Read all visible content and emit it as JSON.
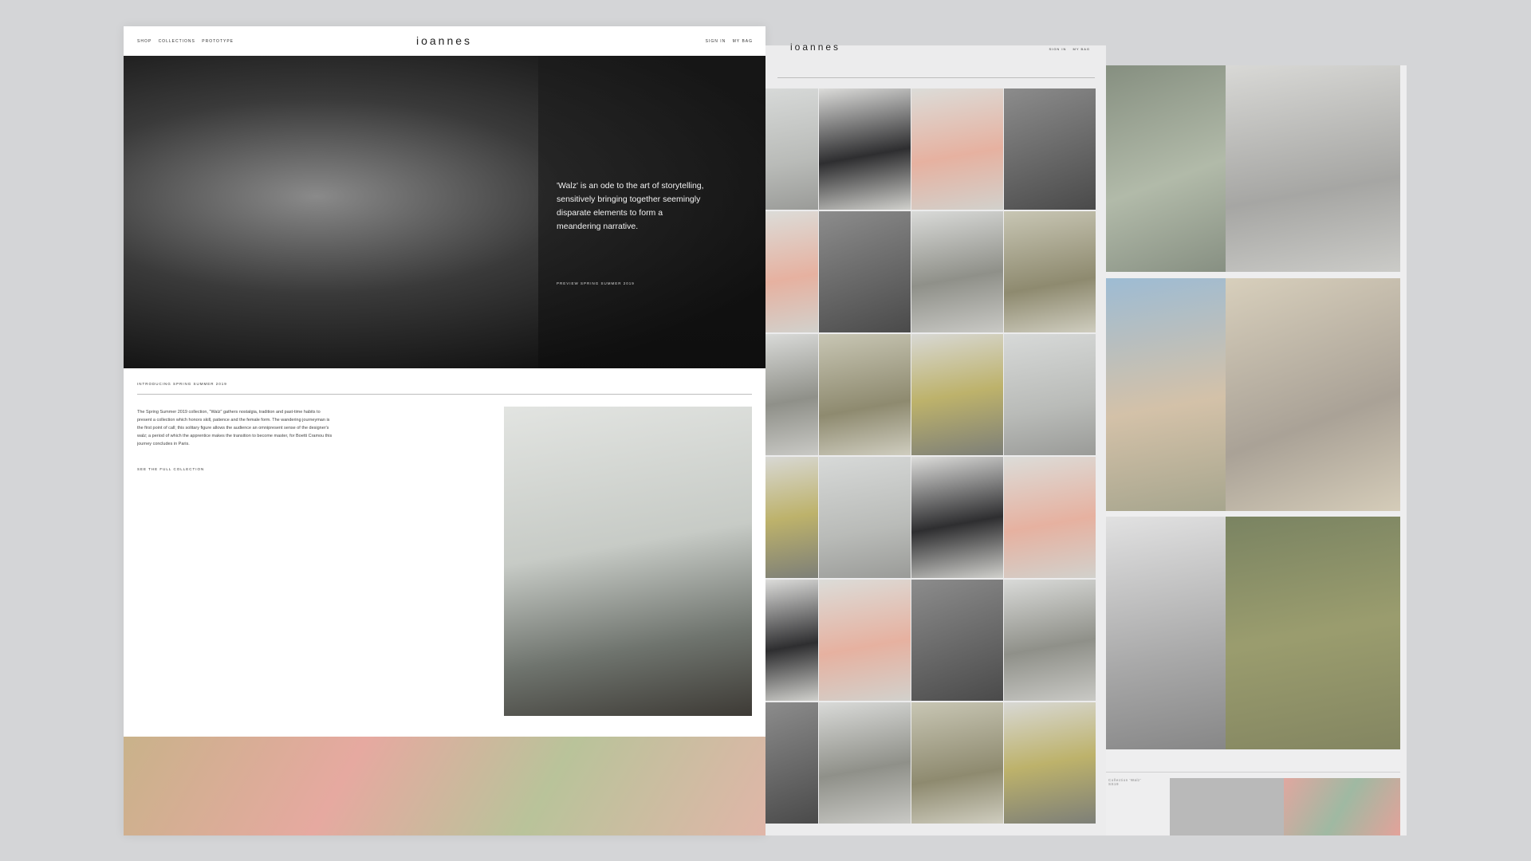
{
  "page1": {
    "nav_links": [
      "SHOP",
      "COLLECTIONS",
      "PROTOTYPE"
    ],
    "logo": "ioannes",
    "account_links": [
      "SIGN IN",
      "MY BAG"
    ],
    "hero": {
      "text": "'Walz' is an ode to the art of storytelling, sensitively bringing together seemingly disparate elements to form a meandering narrative.",
      "link": "PREVIEW SPRING SUMMER 2019"
    },
    "section_label": "INTRODUCING SPRING SUMMER 2019",
    "body": "The Spring Summer 2019 collection, \"Walz\" gathers nostalgia, tradition and past-time habits to present a collection which honors skill, patience and the female form. The wandering journeyman is the first point of call; this solitary figure allows the audience an omnipresent sense of the designer's walz; a period of which the apprentice makes the transition to become master, for Boetti Cramou this journey concludes in Paris.",
    "see_link": "SEE THE FULL COLLECTION"
  },
  "page2": {
    "logo": "ioannes",
    "account_links": [
      "SIGN IN",
      "MY BAG"
    ]
  },
  "page3": {
    "footer_text": [
      "Collection 'Walz'",
      "SS19"
    ]
  },
  "colors": {
    "background": "#d4d5d7",
    "page": "#ffffff",
    "hero_text": "#f2f2f2"
  }
}
